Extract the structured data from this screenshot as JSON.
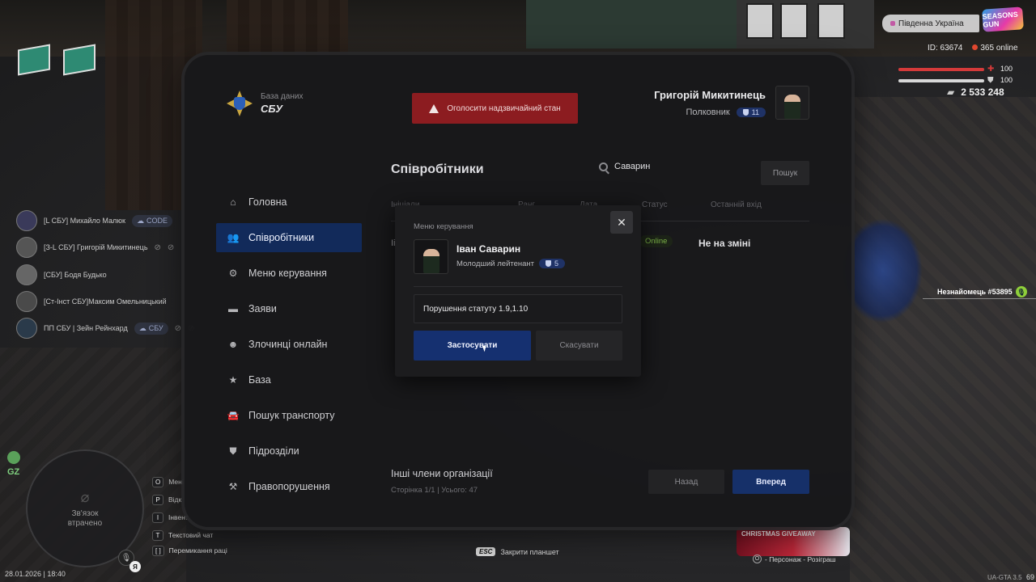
{
  "hud": {
    "region": "Південна Україна",
    "server_logo": "SEASONS GUN",
    "player_id": "ID: 63674",
    "online": "365 online",
    "health": "100",
    "armor": "100",
    "money": "2 533 248"
  },
  "voice_list": [
    {
      "name": "[L СБУ] Михайло Малюк",
      "tag": "CODE"
    },
    {
      "name": "[З-L СБУ] Григорій Микитинець",
      "tag": ""
    },
    {
      "name": "[СБУ] Бодя Будько",
      "tag": ""
    },
    {
      "name": "[Ст-Інст СБУ]Максим Омельницький",
      "tag": ""
    },
    {
      "name": "ПП СБУ | Зейн Рейнхард",
      "tag": "СБУ"
    }
  ],
  "stranger_label": "Незнайомець #53895",
  "minimap": {
    "zone": "GZ",
    "status": "Зв'язок втрачено",
    "mic_badge": "Я"
  },
  "datetime": "28.01.2026 | 18:40",
  "key_hints": [
    {
      "key": "O",
      "label": "Мені"
    },
    {
      "key": "P",
      "label": "Відк"
    },
    {
      "key": "I",
      "label": "Інвент."
    },
    {
      "key": "T",
      "label": "Текстовий чат"
    },
    {
      "key": "[ ]",
      "label": "Перемикання раці"
    }
  ],
  "esc_hint": {
    "key": "ESC",
    "label": "Закрити планшет"
  },
  "giveaway": {
    "title": "CHRISTMAS GIVEAWAY",
    "key": "O",
    "label": "- Персонаж - Розіграш"
  },
  "version": "UA-GTA 3.5",
  "fps": "69",
  "tablet": {
    "brand_sub": "База даних",
    "brand_title": "СБУ",
    "emergency_label": "Оголосити надзвичайний стан",
    "profile": {
      "name": "Григорій Микитинець",
      "rank": "Полковник",
      "level": "11"
    },
    "menu": [
      {
        "label": "Головна",
        "icon": "home-icon"
      },
      {
        "label": "Співробітники",
        "icon": "users-icon"
      },
      {
        "label": "Меню керування",
        "icon": "gear-icon"
      },
      {
        "label": "Заяви",
        "icon": "folder-icon"
      },
      {
        "label": "Злочинці онлайн",
        "icon": "criminal-icon"
      },
      {
        "label": "База",
        "icon": "star-icon"
      },
      {
        "label": "Пошук транспорту",
        "icon": "car-icon"
      },
      {
        "label": "Підрозділи",
        "icon": "shield-icon"
      },
      {
        "label": "Правопорушення",
        "icon": "gavel-icon"
      }
    ],
    "content_title": "Співробітники",
    "search_value": "Саварин",
    "search_button": "Пошук",
    "columns": [
      "Ініціали",
      "Ранг",
      "Дата",
      "Статус",
      "Останній вхід"
    ],
    "row": {
      "name_initial": "Іі",
      "status": "Online",
      "last_login": "Не на зміні"
    },
    "other_title": "Інші члени організації",
    "other_sub": "Сторінка 1/1 | Усього: 47",
    "back_button": "Назад",
    "next_button": "Вперед"
  },
  "modal": {
    "title": "Меню керування",
    "name": "Іван Саварин",
    "rank": "Молодший лейтенант",
    "level": "5",
    "reason_value": "Порушення статуту 1.9,1.10",
    "apply_button": "Застосувати",
    "cancel_button": "Скасувати"
  }
}
